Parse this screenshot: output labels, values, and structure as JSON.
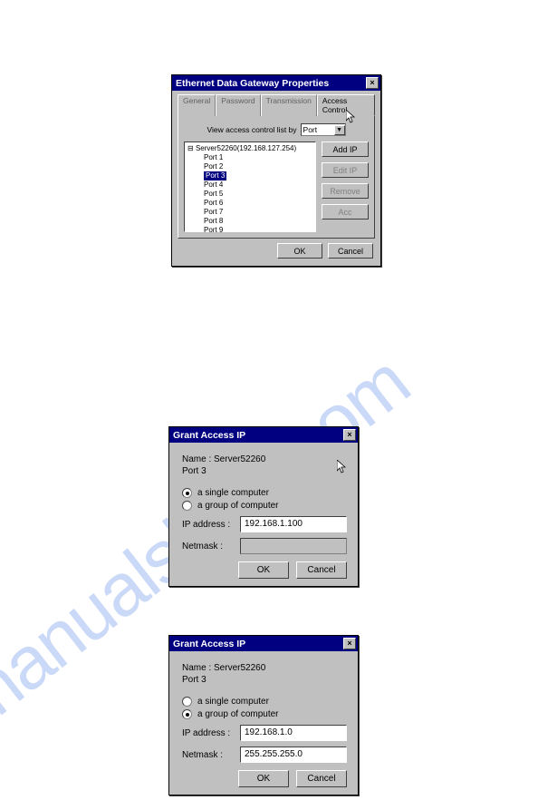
{
  "watermark": "manualshive.com",
  "d1": {
    "title": "Ethernet Data Gateway Properties",
    "tabs": {
      "general": "General",
      "password": "Password",
      "transmission": "Transmission",
      "access": "Access Control"
    },
    "view_label": "View access control list by",
    "combo_value": "Port",
    "tree_root": "Server52260(192.168.127.254)",
    "ports": [
      "Port 1",
      "Port 2",
      "Port 3",
      "Port 4",
      "Port 5",
      "Port 6",
      "Port 7",
      "Port 8",
      "Port 9"
    ],
    "selected_port_index": 2,
    "buttons": {
      "add": "Add IP",
      "edit": "Edit IP",
      "remove": "Remove",
      "acc": "Acc"
    },
    "ok": "OK",
    "cancel": "Cancel"
  },
  "grant_common": {
    "title": "Grant Access IP",
    "name_label": "Name :",
    "name_value": "Server52260",
    "port_label": "Port",
    "radio_single": "a single computer",
    "radio_group": "a group of computer",
    "ip_label": "IP address :",
    "mask_label": "Netmask :",
    "ok": "OK",
    "cancel": "Cancel"
  },
  "d2": {
    "port": "3",
    "mode": "single",
    "ip": "192.168.1.100",
    "mask": ""
  },
  "d3": {
    "port": "3",
    "mode": "group",
    "ip": "192.168.1.0",
    "mask": "255.255.255.0"
  }
}
